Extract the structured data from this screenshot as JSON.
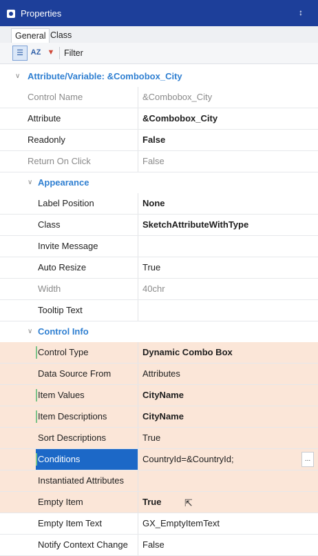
{
  "window": {
    "title": "Properties",
    "pin": "↕"
  },
  "tabs": [
    "General",
    "Class"
  ],
  "toolbar": {
    "filter_label": "Filter",
    "categorized_icon": "☰",
    "az_icon": "AZ",
    "filter_icon": "▼"
  },
  "groups": {
    "attribute": "Attribute/Variable: &Combobox_City",
    "appearance": "Appearance",
    "control_info": "Control Info"
  },
  "rows": {
    "control_name": {
      "label": "Control Name",
      "value": "&Combobox_City"
    },
    "attribute": {
      "label": "Attribute",
      "value": "&Combobox_City"
    },
    "readonly": {
      "label": "Readonly",
      "value": "False"
    },
    "return_on_click": {
      "label": "Return On Click",
      "value": "False"
    },
    "label_position": {
      "label": "Label Position",
      "value": "None"
    },
    "class": {
      "label": "Class",
      "value": "SketchAttributeWithType"
    },
    "invite_message": {
      "label": "Invite Message",
      "value": ""
    },
    "auto_resize": {
      "label": "Auto Resize",
      "value": "True"
    },
    "width": {
      "label": "Width",
      "value": "40chr"
    },
    "tooltip_text": {
      "label": "Tooltip Text",
      "value": ""
    },
    "control_type": {
      "label": "Control Type",
      "value": "Dynamic Combo Box"
    },
    "data_source_from": {
      "label": "Data Source From",
      "value": "Attributes"
    },
    "item_values": {
      "label": "Item Values",
      "value": "CityName"
    },
    "item_descriptions": {
      "label": "Item Descriptions",
      "value": "CityName"
    },
    "sort_descriptions": {
      "label": "Sort Descriptions",
      "value": "True"
    },
    "conditions": {
      "label": "Conditions",
      "value": "CountryId=&CountryId;"
    },
    "instantiated_attributes": {
      "label": "Instantiated Attributes",
      "value": ""
    },
    "empty_item": {
      "label": "Empty Item",
      "value": "True"
    },
    "empty_item_text": {
      "label": "Empty Item Text",
      "value": "GX_EmptyItemText"
    },
    "notify_context_change": {
      "label": "Notify Context Change",
      "value": "False"
    }
  },
  "colors": {
    "titlebar": "#1d3f9a",
    "group_text": "#2f7fd1",
    "highlight": "#fbe6d8",
    "selected": "#1c68c7"
  }
}
